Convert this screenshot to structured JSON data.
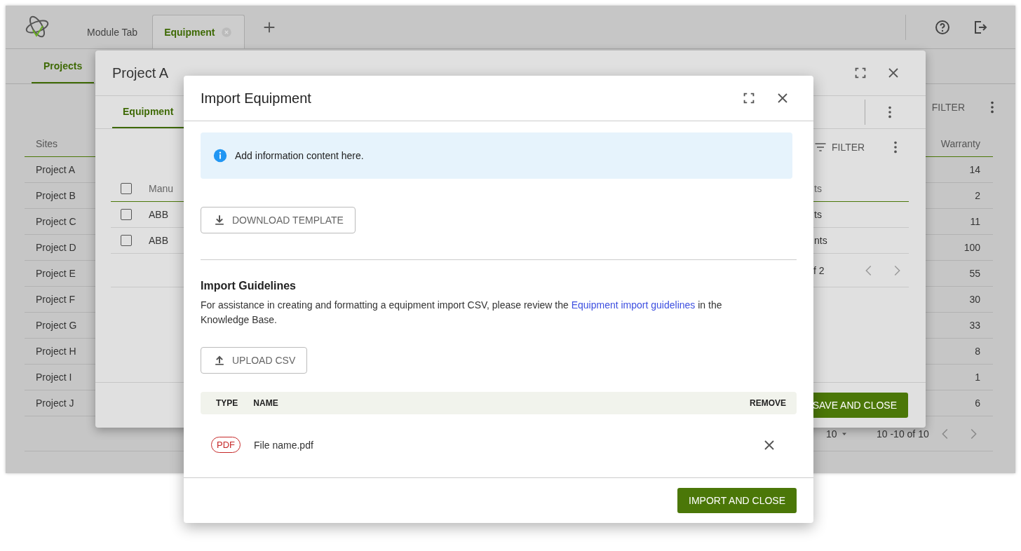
{
  "app": {
    "tabs": [
      {
        "label": "Module Tab",
        "selected": false,
        "closable": false
      },
      {
        "label": "Equipment",
        "selected": true,
        "closable": true
      }
    ],
    "nav_tabs": [
      {
        "label": "Projects",
        "selected": true
      }
    ],
    "filter_label": "FILTER",
    "sites_table": {
      "columns": [
        "Sites",
        "Warranty"
      ],
      "rows": [
        {
          "site": "Project A",
          "warranty": "14"
        },
        {
          "site": "Project B",
          "warranty": "2"
        },
        {
          "site": "Project C",
          "warranty": "11"
        },
        {
          "site": "Project D",
          "warranty": "100"
        },
        {
          "site": "Project E",
          "warranty": "55"
        },
        {
          "site": "Project F",
          "warranty": "30"
        },
        {
          "site": "Project G",
          "warranty": "33"
        },
        {
          "site": "Project H",
          "warranty": "8"
        },
        {
          "site": "Project I",
          "warranty": "1"
        },
        {
          "site": "Project J",
          "warranty": "6"
        }
      ]
    },
    "pagination": {
      "page_size": "10",
      "range": "10 -10 of 10"
    }
  },
  "project_dialog": {
    "title": "Project A",
    "tabs": [
      {
        "label": "Equipment",
        "selected": true
      }
    ],
    "filter_label": "FILTER",
    "header_checked": false,
    "columns": [
      "Manu",
      "ts"
    ],
    "rows": [
      {
        "checked": false,
        "manufacturer": "ABB",
        "column_2": "ts"
      },
      {
        "checked": false,
        "manufacturer": "ABB",
        "column_2": "nts"
      }
    ],
    "pagination": "f 2",
    "save_button": "SAVE AND CLOSE"
  },
  "import_dialog": {
    "title": "Import Equipment",
    "info": "Add information content here.",
    "download_button": "DOWNLOAD TEMPLATE",
    "guidelines": {
      "heading": "Import Guidelines",
      "text_before": "For assistance in creating and formatting a equipment import CSV, please review the ",
      "link": "Equipment import guidelines",
      "text_after": " in the Knowledge Base."
    },
    "upload_button": "UPLOAD CSV",
    "files_table": {
      "columns": [
        "TYPE",
        "NAME",
        "REMOVE"
      ],
      "rows": [
        {
          "type": "PDF",
          "name": "File name.pdf"
        }
      ]
    },
    "import_button": "IMPORT AND CLOSE"
  }
}
